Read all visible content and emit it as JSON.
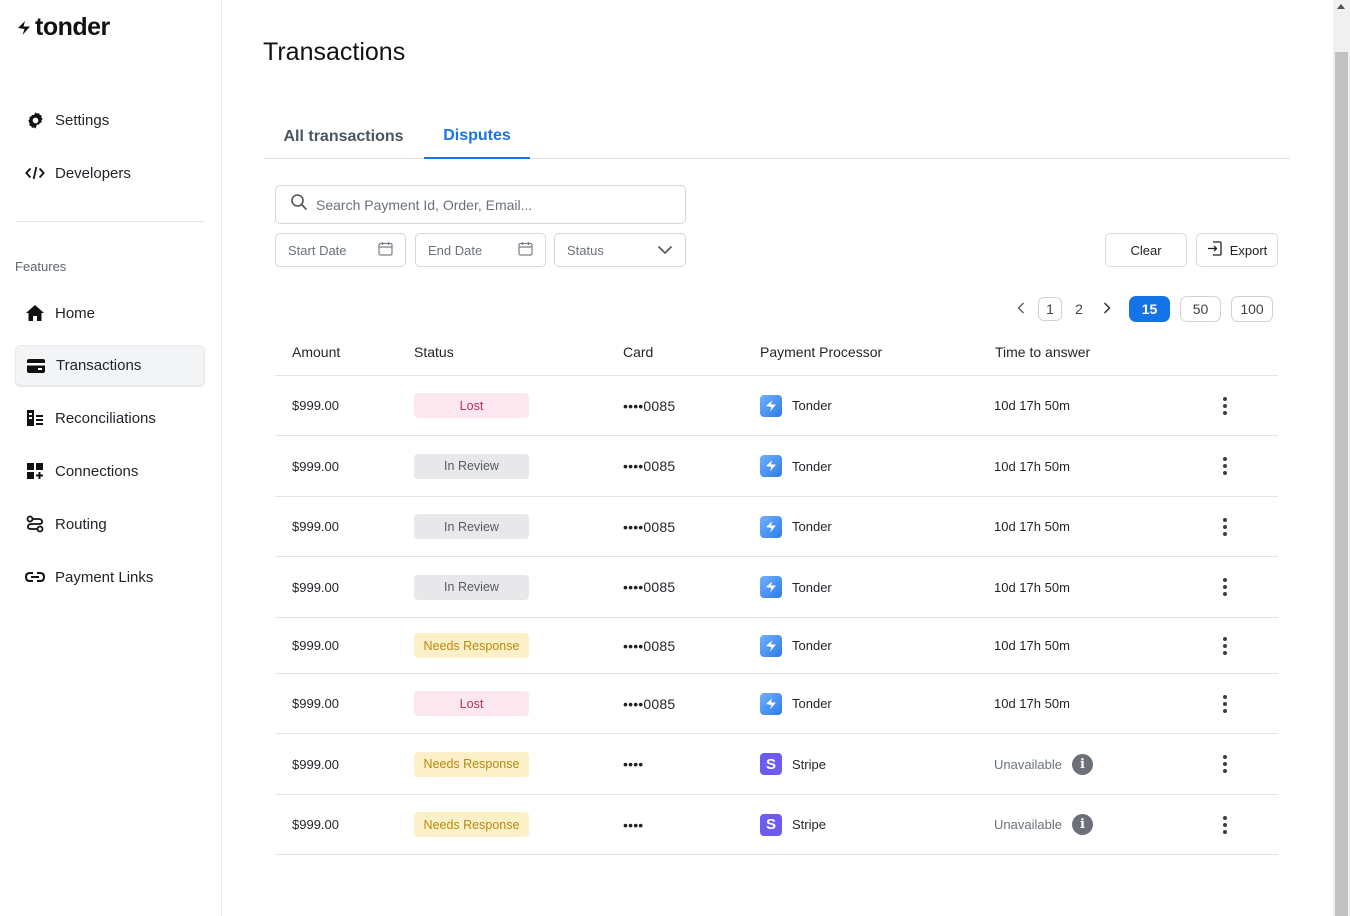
{
  "brand": {
    "name": "tonder"
  },
  "sidebar": {
    "top_items": [
      {
        "label": "Settings",
        "icon": "gear-icon"
      },
      {
        "label": "Developers",
        "icon": "code-icon"
      }
    ],
    "section_label": "Features",
    "items": [
      {
        "label": "Home",
        "icon": "home-icon"
      },
      {
        "label": "Transactions",
        "icon": "wallet-icon",
        "active": true
      },
      {
        "label": "Reconciliations",
        "icon": "reconciliations-icon"
      },
      {
        "label": "Connections",
        "icon": "connections-icon"
      },
      {
        "label": "Routing",
        "icon": "routing-icon"
      },
      {
        "label": "Payment Links",
        "icon": "link-icon"
      }
    ]
  },
  "page": {
    "title": "Transactions"
  },
  "tabs": [
    {
      "label": "All transactions",
      "active": false
    },
    {
      "label": "Disputes",
      "active": true
    }
  ],
  "filters": {
    "search_placeholder": "Search Payment Id, Order, Email...",
    "start_date": "Start Date",
    "end_date": "End Date",
    "status": "Status",
    "clear_label": "Clear",
    "export_label": "Export"
  },
  "pagination": {
    "pages": [
      "1",
      "2"
    ],
    "current_page": "1",
    "page_sizes": [
      "15",
      "50",
      "100"
    ],
    "selected_size": "15"
  },
  "table": {
    "headers": [
      "Amount",
      "Status",
      "Card",
      "Payment Processor",
      "Time to answer"
    ],
    "rows": [
      {
        "amount": "$999.00",
        "status": "Lost",
        "status_kind": "lost",
        "card": "••••0085",
        "processor": "Tonder",
        "processor_kind": "tonder",
        "time": "10d 17h 50m"
      },
      {
        "amount": "$999.00",
        "status": "In Review",
        "status_kind": "review",
        "card": "••••0085",
        "processor": "Tonder",
        "processor_kind": "tonder",
        "time": "10d 17h 50m"
      },
      {
        "amount": "$999.00",
        "status": "In Review",
        "status_kind": "review",
        "card": "••••0085",
        "processor": "Tonder",
        "processor_kind": "tonder",
        "time": "10d 17h 50m"
      },
      {
        "amount": "$999.00",
        "status": "In Review",
        "status_kind": "review",
        "card": "••••0085",
        "processor": "Tonder",
        "processor_kind": "tonder",
        "time": "10d 17h 50m"
      },
      {
        "amount": "$999.00",
        "status": "Needs Response",
        "status_kind": "needs",
        "card": "••••0085",
        "processor": "Tonder",
        "processor_kind": "tonder",
        "time": "10d 17h 50m"
      },
      {
        "amount": "$999.00",
        "status": "Lost",
        "status_kind": "lost",
        "card": "••••0085",
        "processor": "Tonder",
        "processor_kind": "tonder",
        "time": "10d 17h 50m"
      },
      {
        "amount": "$999.00",
        "status": "Needs Response",
        "status_kind": "needs",
        "card": "••••",
        "processor": "Stripe",
        "processor_kind": "stripe",
        "time": "Unavailable",
        "time_info": true
      },
      {
        "amount": "$999.00",
        "status": "Needs Response",
        "status_kind": "needs",
        "card": "••••",
        "processor": "Stripe",
        "processor_kind": "stripe",
        "time": "Unavailable",
        "time_info": true
      }
    ]
  },
  "colors": {
    "accent": "#1473e6",
    "lost_bg": "#fde7ee",
    "review_bg": "#e8e8ea",
    "needs_bg": "#fbf0c7"
  }
}
